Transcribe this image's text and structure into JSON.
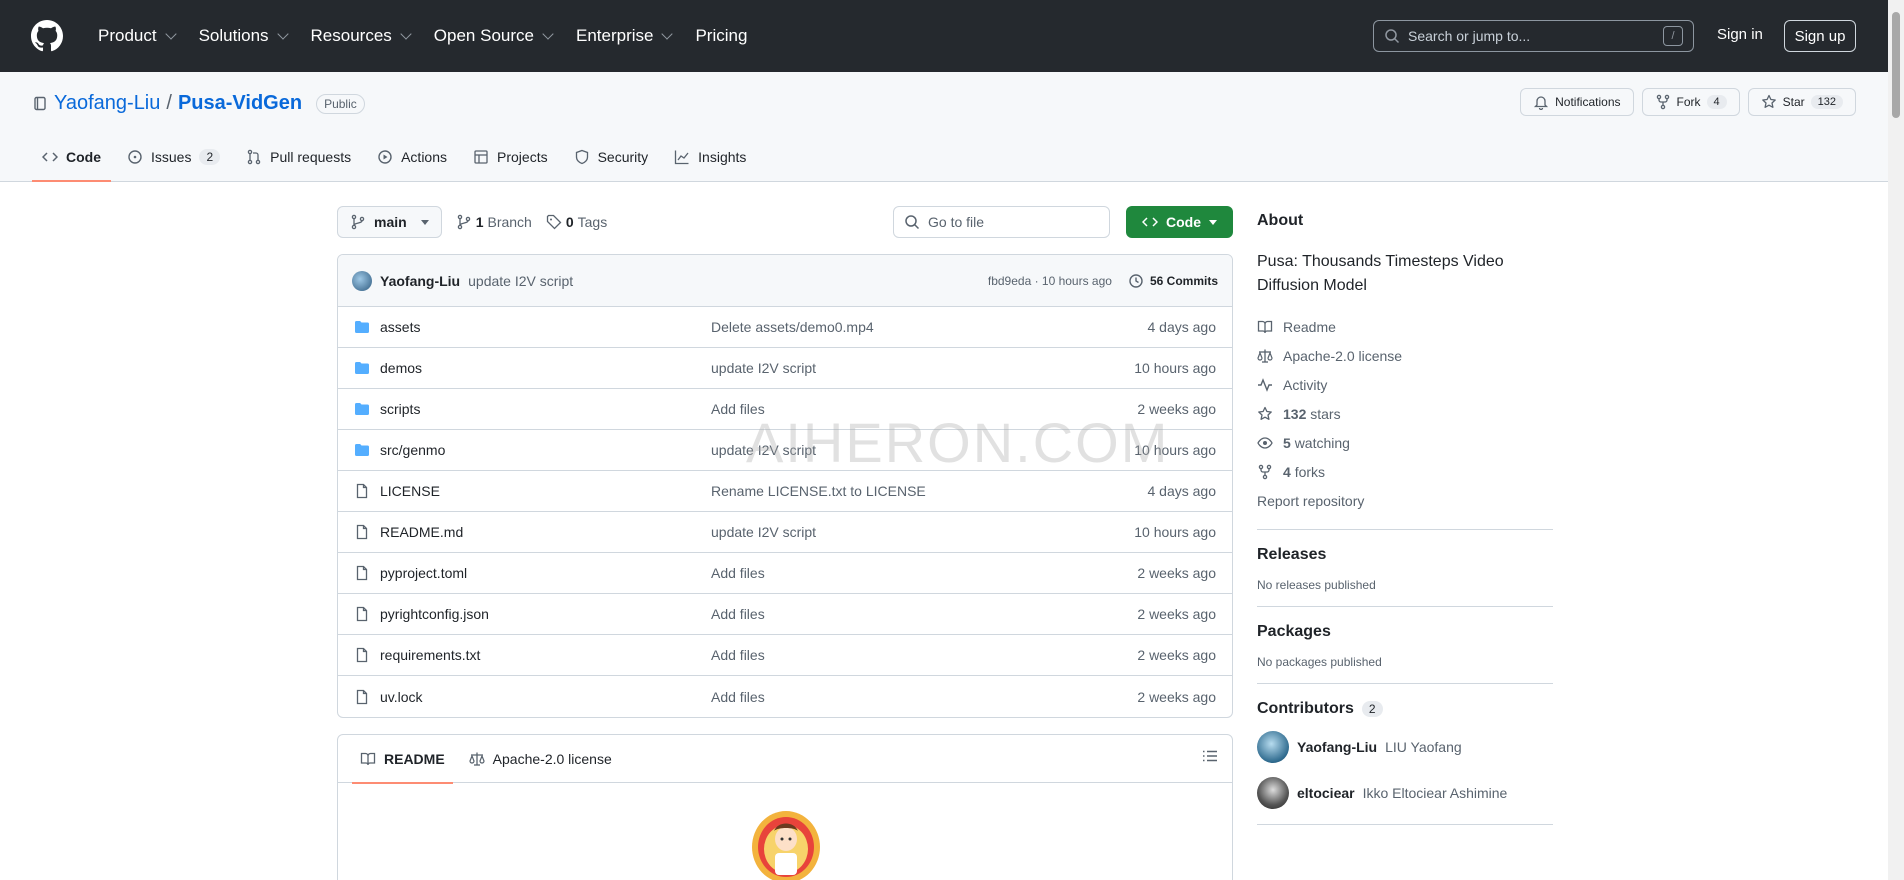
{
  "topnav": {
    "items": [
      {
        "label": "Product",
        "dropdown": true
      },
      {
        "label": "Solutions",
        "dropdown": true
      },
      {
        "label": "Resources",
        "dropdown": true
      },
      {
        "label": "Open Source",
        "dropdown": true
      },
      {
        "label": "Enterprise",
        "dropdown": true
      },
      {
        "label": "Pricing",
        "dropdown": false
      }
    ],
    "search_placeholder": "Search or jump to...",
    "search_kbd": "/",
    "signin": "Sign in",
    "signup": "Sign up"
  },
  "repo": {
    "owner": "Yaofang-Liu",
    "separator": "/",
    "name": "Pusa-VidGen",
    "visibility": "Public",
    "notifications_label": "Notifications",
    "fork_label": "Fork",
    "fork_count": "4",
    "star_label": "Star",
    "star_count": "132"
  },
  "tabs": [
    {
      "label": "Code",
      "icon": "code-icon",
      "active": true
    },
    {
      "label": "Issues",
      "icon": "issue-icon",
      "count": "2"
    },
    {
      "label": "Pull requests",
      "icon": "pull-request-icon"
    },
    {
      "label": "Actions",
      "icon": "play-icon"
    },
    {
      "label": "Projects",
      "icon": "table-icon"
    },
    {
      "label": "Security",
      "icon": "shield-icon"
    },
    {
      "label": "Insights",
      "icon": "graph-icon"
    }
  ],
  "toolbar": {
    "branch": "main",
    "branch_count": "1",
    "branch_label": "Branch",
    "tag_count": "0",
    "tag_label": "Tags",
    "goto_placeholder": "Go to file",
    "code_button": "Code"
  },
  "latest_commit": {
    "author": "Yaofang-Liu",
    "message": "update I2V script",
    "hash_time": "fbd9eda · 10 hours ago",
    "commits": "56 Commits"
  },
  "files": [
    {
      "type": "dir",
      "name": "assets",
      "message": "Delete assets/demo0.mp4",
      "time": "4 days ago"
    },
    {
      "type": "dir",
      "name": "demos",
      "message": "update I2V script",
      "time": "10 hours ago"
    },
    {
      "type": "dir",
      "name": "scripts",
      "message": "Add files",
      "time": "2 weeks ago"
    },
    {
      "type": "dir",
      "name": "src/genmo",
      "message": "update I2V script",
      "time": "10 hours ago"
    },
    {
      "type": "file",
      "name": "LICENSE",
      "message": "Rename LICENSE.txt to LICENSE",
      "time": "4 days ago"
    },
    {
      "type": "file",
      "name": "README.md",
      "message": "update I2V script",
      "time": "10 hours ago"
    },
    {
      "type": "file",
      "name": "pyproject.toml",
      "message": "Add files",
      "time": "2 weeks ago"
    },
    {
      "type": "file",
      "name": "pyrightconfig.json",
      "message": "Add files",
      "time": "2 weeks ago"
    },
    {
      "type": "file",
      "name": "requirements.txt",
      "message": "Add files",
      "time": "2 weeks ago"
    },
    {
      "type": "file",
      "name": "uv.lock",
      "message": "Add files",
      "time": "2 weeks ago"
    }
  ],
  "readme_tabs": {
    "readme": "README",
    "license": "Apache-2.0 license"
  },
  "about": {
    "heading": "About",
    "description": "Pusa: Thousands Timesteps Video Diffusion Model",
    "readme": "Readme",
    "license": "Apache-2.0 license",
    "activity": "Activity",
    "stars_count": "132",
    "stars_label": "stars",
    "watching_count": "5",
    "watching_label": "watching",
    "forks_count": "4",
    "forks_label": "forks",
    "report": "Report repository"
  },
  "releases": {
    "heading": "Releases",
    "text": "No releases published"
  },
  "packages": {
    "heading": "Packages",
    "text": "No packages published"
  },
  "contributors": {
    "heading": "Contributors",
    "count": "2",
    "people": [
      {
        "login": "Yaofang-Liu",
        "full": "LIU Yaofang"
      },
      {
        "login": "eltociear",
        "full": "Ikko Eltociear Ashimine"
      }
    ]
  },
  "watermark": "AIHERON.COM"
}
